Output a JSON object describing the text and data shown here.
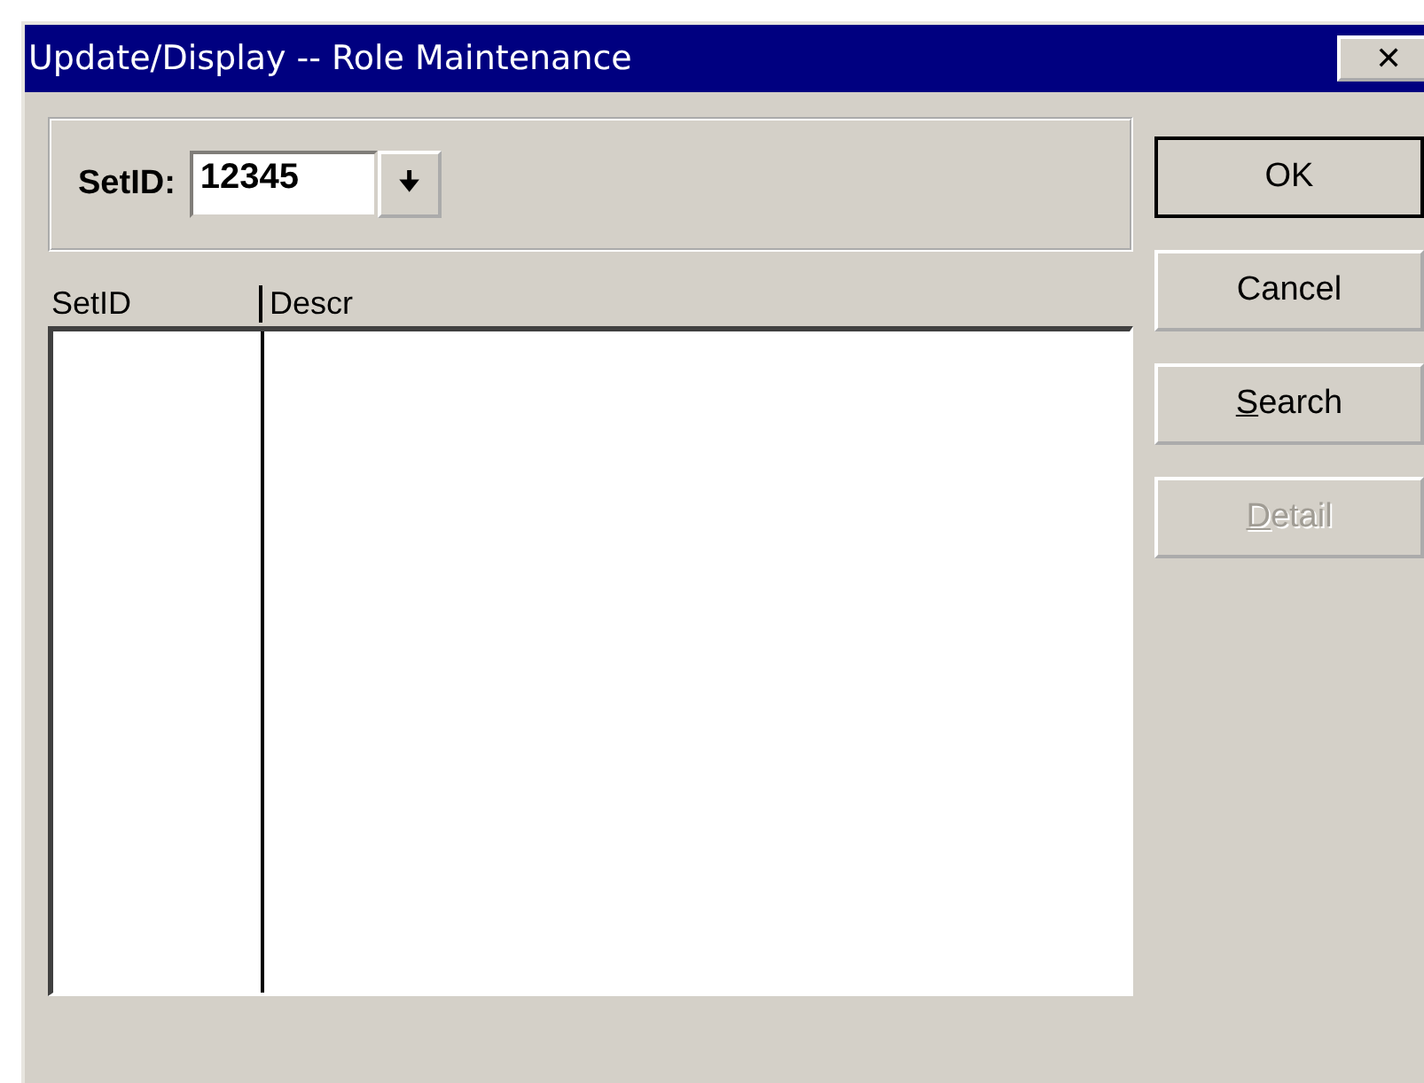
{
  "window": {
    "title": "Update/Display -- Role Maintenance",
    "close": "✕"
  },
  "setid_field": {
    "label": "SetID:",
    "value": "12345",
    "dropdown": "🠋"
  },
  "list": {
    "columns": [
      {
        "label": "SetID"
      },
      {
        "label": "Descr"
      }
    ]
  },
  "buttons": [
    {
      "label": "OK",
      "default": true,
      "disabled": false,
      "mnemonic": false
    },
    {
      "label": "Cancel",
      "default": false,
      "disabled": false,
      "mnemonic": false
    },
    {
      "label": "Search",
      "default": false,
      "disabled": false,
      "mnemonic": true
    },
    {
      "label": "Detail",
      "default": false,
      "disabled": true,
      "mnemonic": true
    }
  ]
}
